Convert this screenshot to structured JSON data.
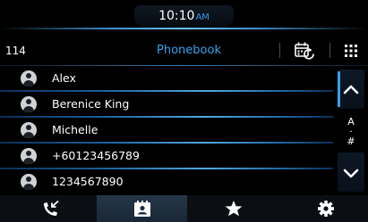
{
  "status_bar": {
    "time": "10:10",
    "ampm": "AM"
  },
  "header": {
    "count": "114",
    "title": "Phonebook",
    "sync_icon": "calendar-sync-icon",
    "menu_icon": "grid-menu-icon"
  },
  "contacts": [
    {
      "name": "Alex"
    },
    {
      "name": "Berenice King"
    },
    {
      "name": "Michelle"
    },
    {
      "name": "+60123456789"
    },
    {
      "name": "1234567890"
    }
  ],
  "side_panel": {
    "index_top": "A",
    "index_dot": "·",
    "index_bottom": "#",
    "up_icon": "chevron-up-icon",
    "down_icon": "chevron-down-icon"
  },
  "bottom_nav": {
    "tabs": [
      {
        "icon": "recent-calls-icon"
      },
      {
        "icon": "phonebook-icon",
        "selected": true
      },
      {
        "icon": "star-icon"
      },
      {
        "icon": "gear-icon"
      }
    ]
  },
  "colors": {
    "accent": "#37a3ef",
    "background": "#000000",
    "text": "#ffffff"
  }
}
